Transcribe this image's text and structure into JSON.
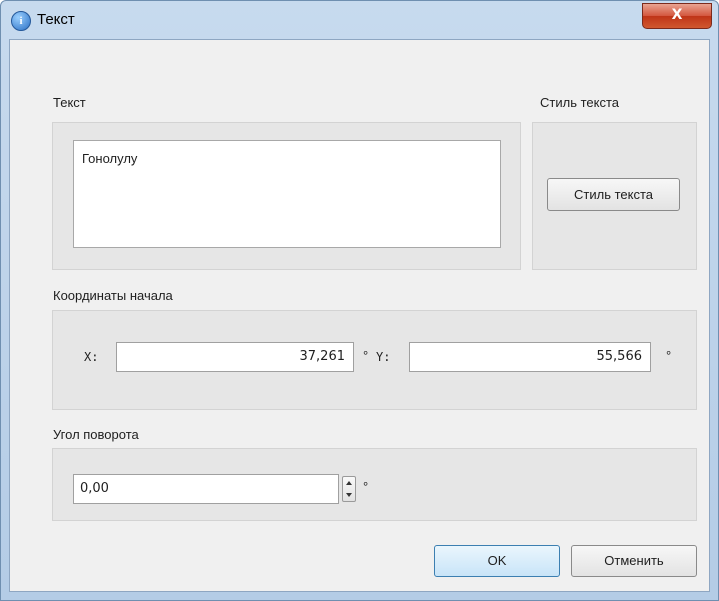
{
  "window": {
    "title": "Текст",
    "info_icon_glyph": "i",
    "close_glyph": "X"
  },
  "text_section": {
    "label": "Текст",
    "value": "Гонолулу"
  },
  "style_section": {
    "label": "Стиль текста",
    "button_label": "Стиль текста"
  },
  "coords": {
    "label": "Координаты начала",
    "x_label": "X:",
    "x_value": "37,261",
    "y_label": "Y:",
    "y_value": "55,566",
    "degree_symbol": "°"
  },
  "rotation": {
    "label": "Угол поворота",
    "value": "0,00",
    "degree_symbol": "°"
  },
  "buttons": {
    "ok": "OK",
    "cancel": "Отменить"
  }
}
